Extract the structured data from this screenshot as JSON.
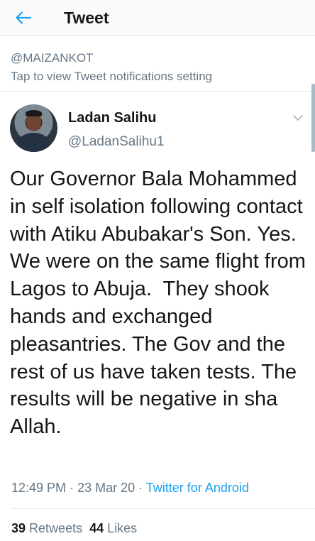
{
  "header": {
    "title": "Tweet",
    "back_icon": "arrow-left-icon",
    "accent_color": "#1da1f2"
  },
  "notification": {
    "handle": "@MAIZANKOT",
    "text": "Tap to view Tweet notifications setting"
  },
  "tweet": {
    "author": {
      "name": "Ladan Salihu",
      "handle": "@LadanSalihu1"
    },
    "text": "Our Governor Bala Mohammed in self isolation following contact with Atiku Abubakar's Son. Yes. We were on the same flight from Lagos to Abuja.  They shook hands and exchanged pleasantries. The Gov and the rest of us have taken tests. The results will be negative in sha Allah.",
    "time": "12:49 PM",
    "date": "23 Mar 20",
    "source": "Twitter for Android",
    "retweets": {
      "count": "39",
      "label": "Retweets"
    },
    "likes": {
      "count": "44",
      "label": "Likes"
    }
  }
}
